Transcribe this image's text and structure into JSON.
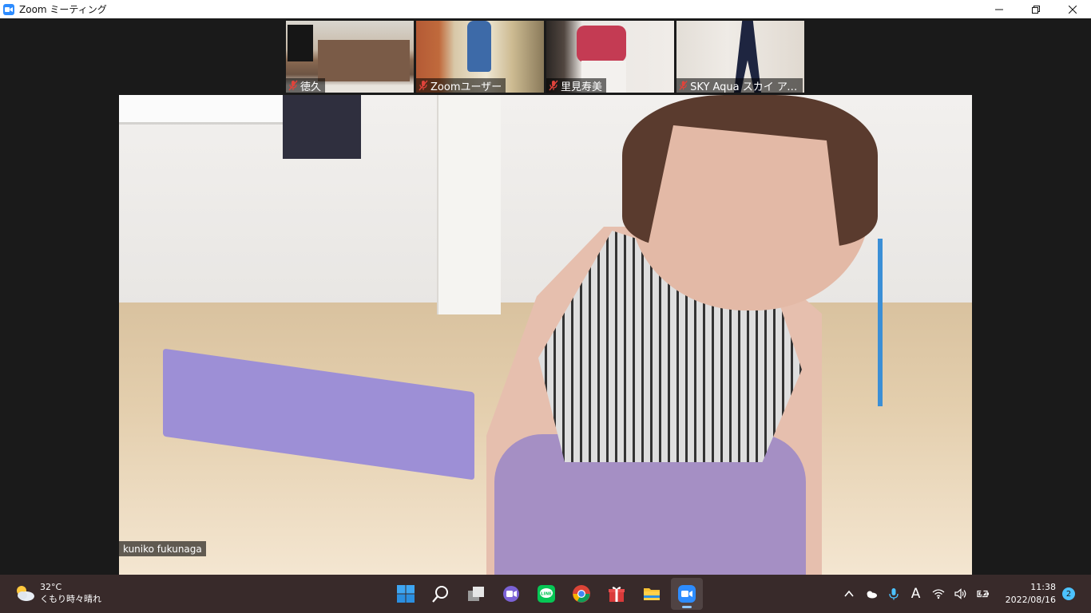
{
  "window": {
    "title": "Zoom ミーティング",
    "minimize_icon": "minimize-icon",
    "restore_icon": "restore-icon",
    "close_icon": "close-icon"
  },
  "participants": [
    {
      "name": "徳久",
      "muted": true
    },
    {
      "name": "Zoomユーザー",
      "muted": true
    },
    {
      "name": "里見寿美",
      "muted": true
    },
    {
      "name": "SKY Aqua スカイ アク...",
      "muted": true
    }
  ],
  "active_speaker": {
    "name": "kuniko fukunaga"
  },
  "taskbar": {
    "weather": {
      "temp": "32°C",
      "condition": "くもり時々晴れ"
    },
    "apps": [
      "start",
      "search",
      "task-view",
      "chat",
      "line",
      "chrome",
      "gift",
      "file-explorer",
      "zoom"
    ],
    "ime": "A",
    "time": "11:38",
    "date": "2022/08/16",
    "notification_count": "2"
  },
  "colors": {
    "zoom_blue": "#2d8cff",
    "muted_red": "#e0433b",
    "taskbar_bg": "#382a2a",
    "meeting_bg": "#1a1a1a"
  }
}
